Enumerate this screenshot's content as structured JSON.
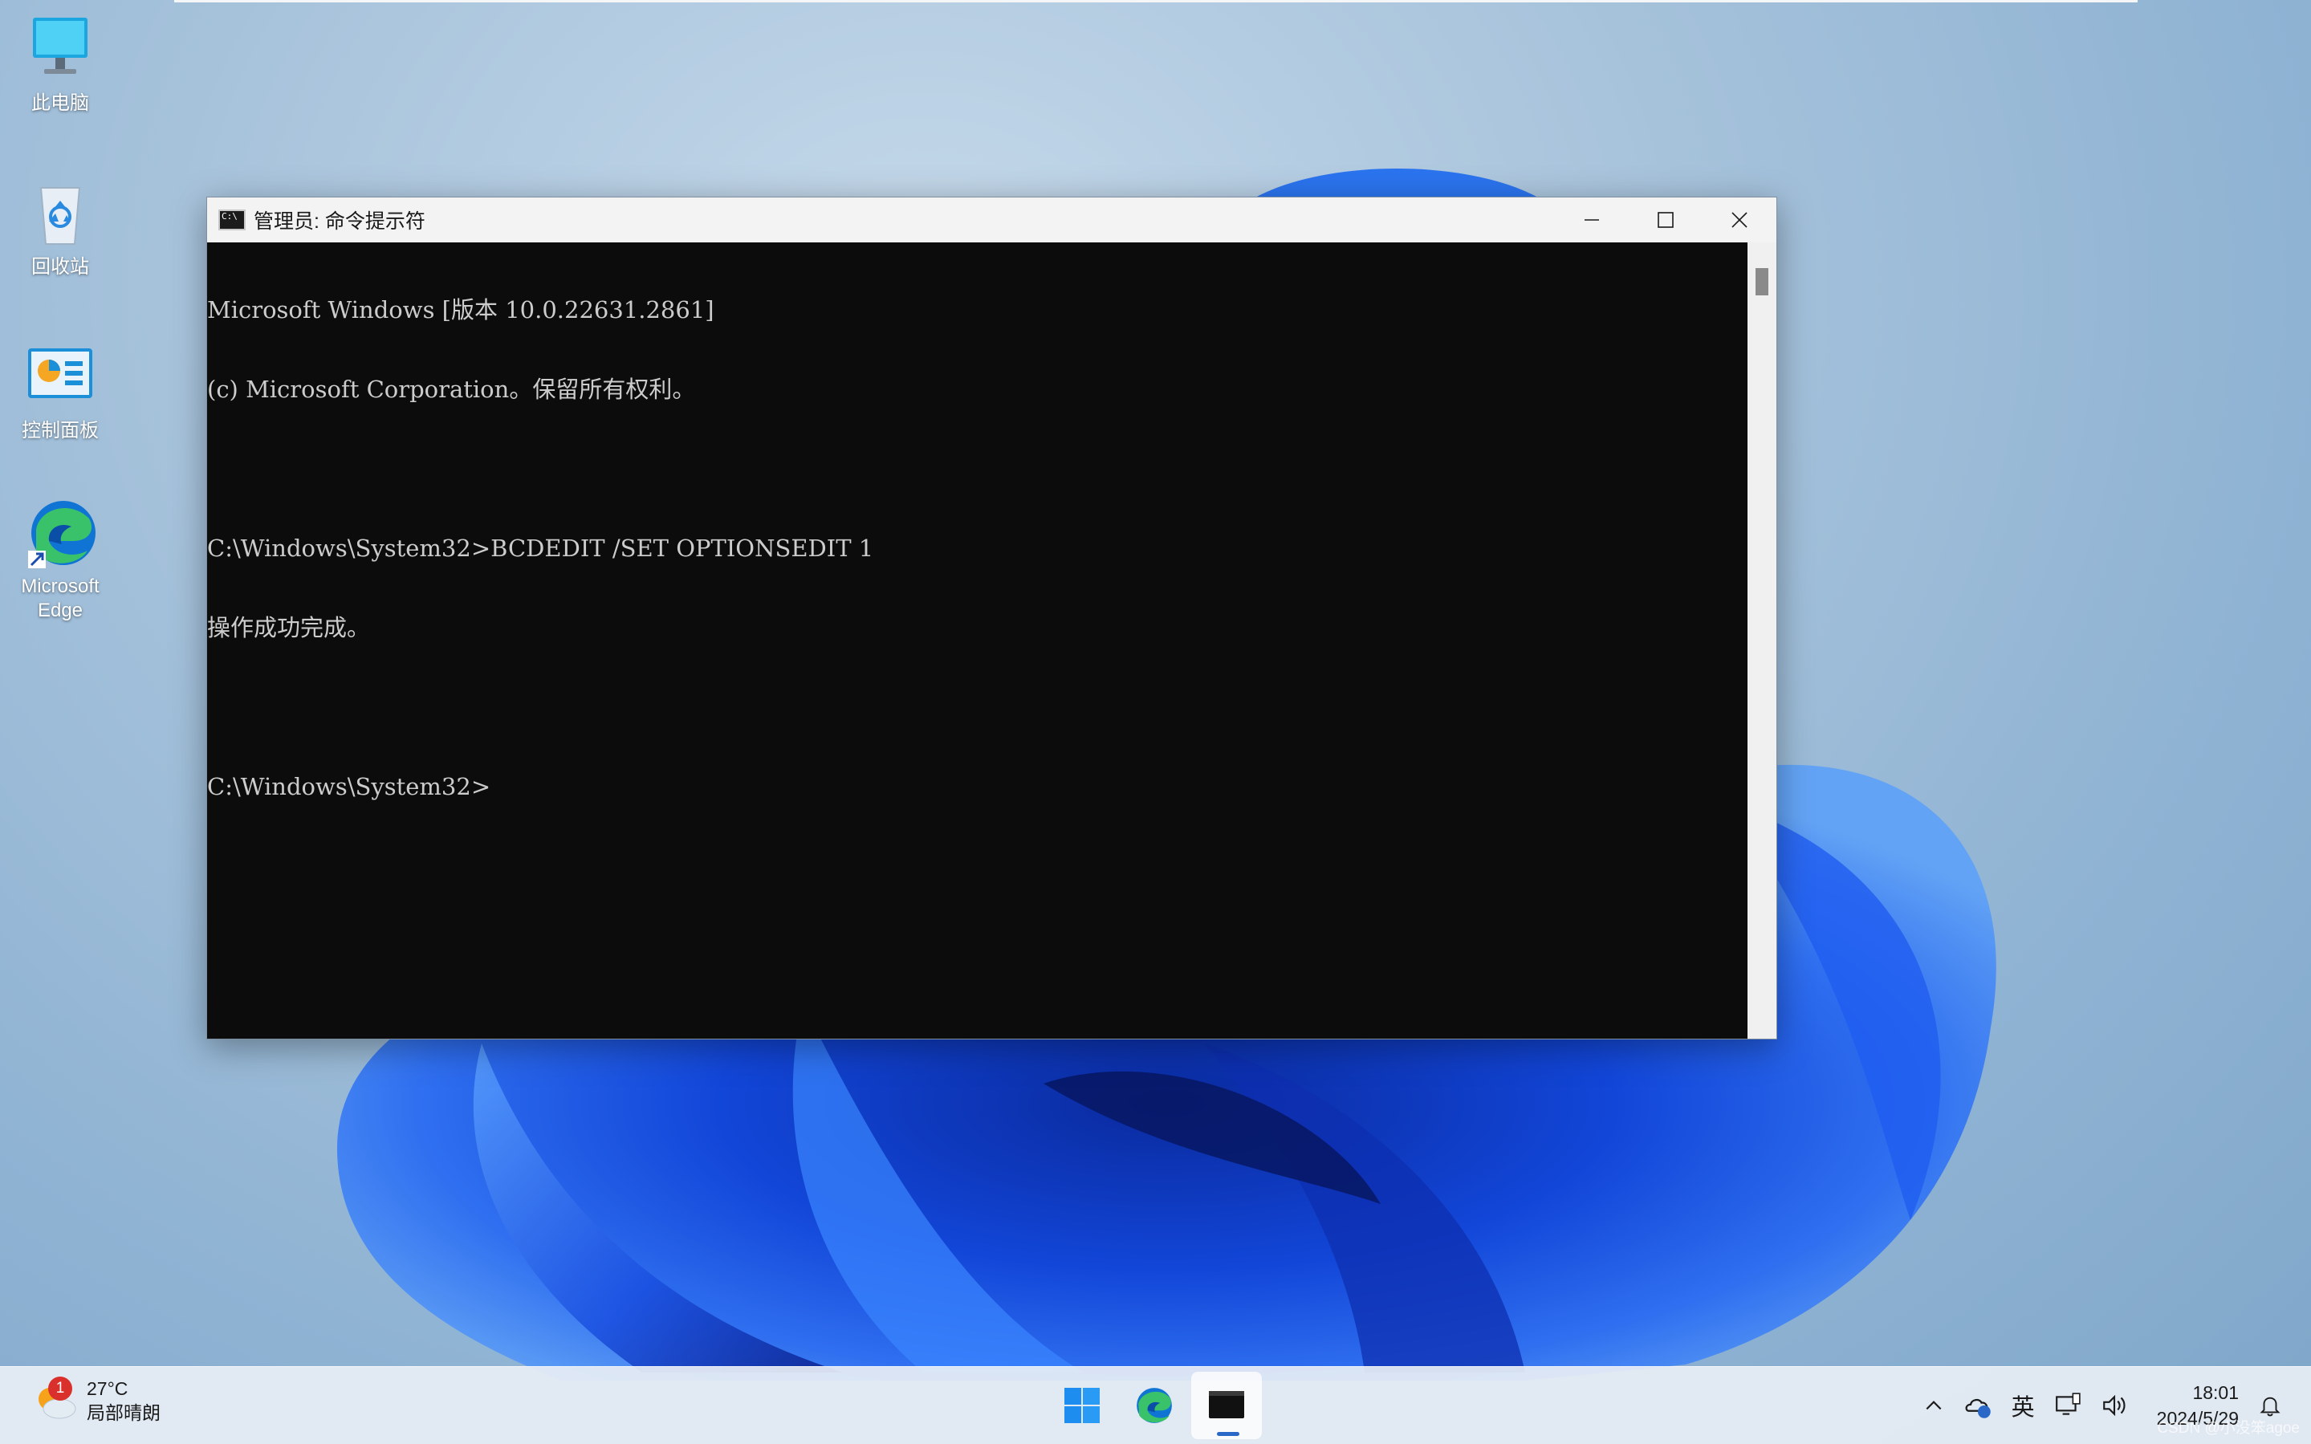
{
  "desktop": {
    "icons": [
      {
        "label": "此电脑",
        "icon": "computer-icon"
      },
      {
        "label": "回收站",
        "icon": "recycle-bin-icon"
      },
      {
        "label": "控制面板",
        "icon": "control-panel-icon"
      },
      {
        "label": "Microsoft Edge",
        "label_line1": "Microsoft",
        "label_line2": "Edge",
        "icon": "edge-shortcut-icon"
      }
    ]
  },
  "cmd_window": {
    "title": "管理员: 命令提示符",
    "icon": "cmd-icon",
    "caption_buttons": [
      "minimize-icon",
      "maximize-icon",
      "close-icon"
    ],
    "console_lines": [
      "Microsoft Windows [版本 10.0.22631.2861]",
      "(c) Microsoft Corporation。保留所有权利。",
      "",
      "C:\\Windows\\System32>BCDEDIT /SET OPTIONSEDIT 1",
      "操作成功完成。",
      "",
      "C:\\Windows\\System32>"
    ],
    "colors": {
      "background": "#0c0c0c",
      "text": "#cccccc"
    }
  },
  "taskbar": {
    "weather": {
      "temperature": "27°C",
      "condition": "局部晴朗",
      "badge": "1",
      "icon": "partly-cloudy-icon"
    },
    "pinned": [
      {
        "name": "start",
        "icon": "windows-start-icon"
      },
      {
        "name": "edge",
        "icon": "edge-icon"
      },
      {
        "name": "cmd",
        "icon": "terminal-icon",
        "active": true
      }
    ],
    "tray": {
      "overflow_icon": "chevron-up-icon",
      "onedrive_icon": "cloud-icon",
      "ime": "英",
      "network_icon": "network-icon",
      "volume_icon": "volume-icon",
      "time": "18:01",
      "date": "2024/5/29",
      "notification_icon": "bell-icon"
    },
    "accent": "#2a68c8"
  },
  "watermark": "CSDN @小没笨agoe"
}
